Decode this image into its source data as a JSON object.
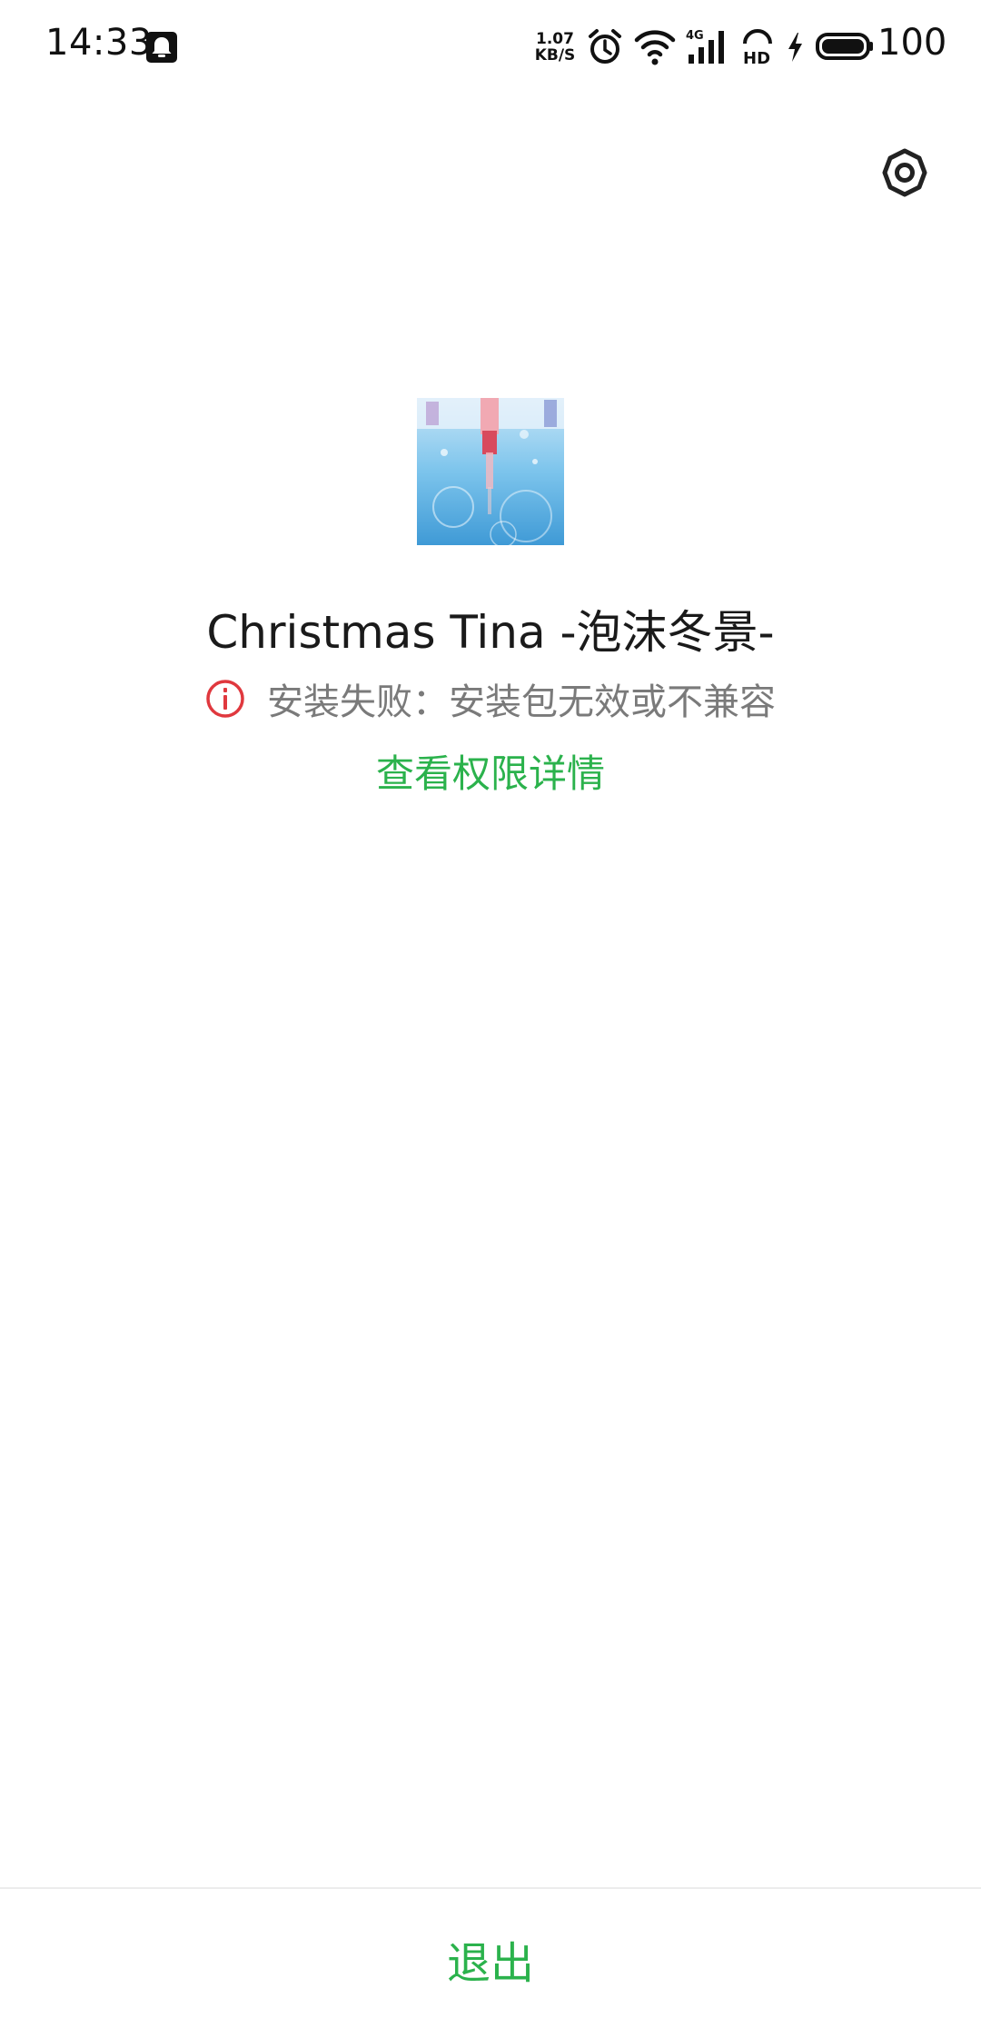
{
  "status_bar": {
    "time": "14:33",
    "net_speed_value": "1.07",
    "net_speed_unit": "KB/S",
    "battery": "100",
    "icons": [
      "notification-bell-icon",
      "alarm-icon",
      "wifi-icon",
      "4g-signal-icon",
      "hd-icon",
      "charging-icon",
      "battery-icon"
    ]
  },
  "settings": {
    "icon": "gear-icon"
  },
  "app": {
    "name": "Christmas Tina -泡沫冬景-",
    "status_message": "安装失败：安装包无效或不兼容",
    "permission_link": "查看权限详情"
  },
  "footer": {
    "exit_label": "退出"
  },
  "colors": {
    "accent_green": "#2bb24c",
    "error_red": "#e0383e",
    "text_primary": "#1a1a1a",
    "text_secondary": "#7a7a7a"
  }
}
